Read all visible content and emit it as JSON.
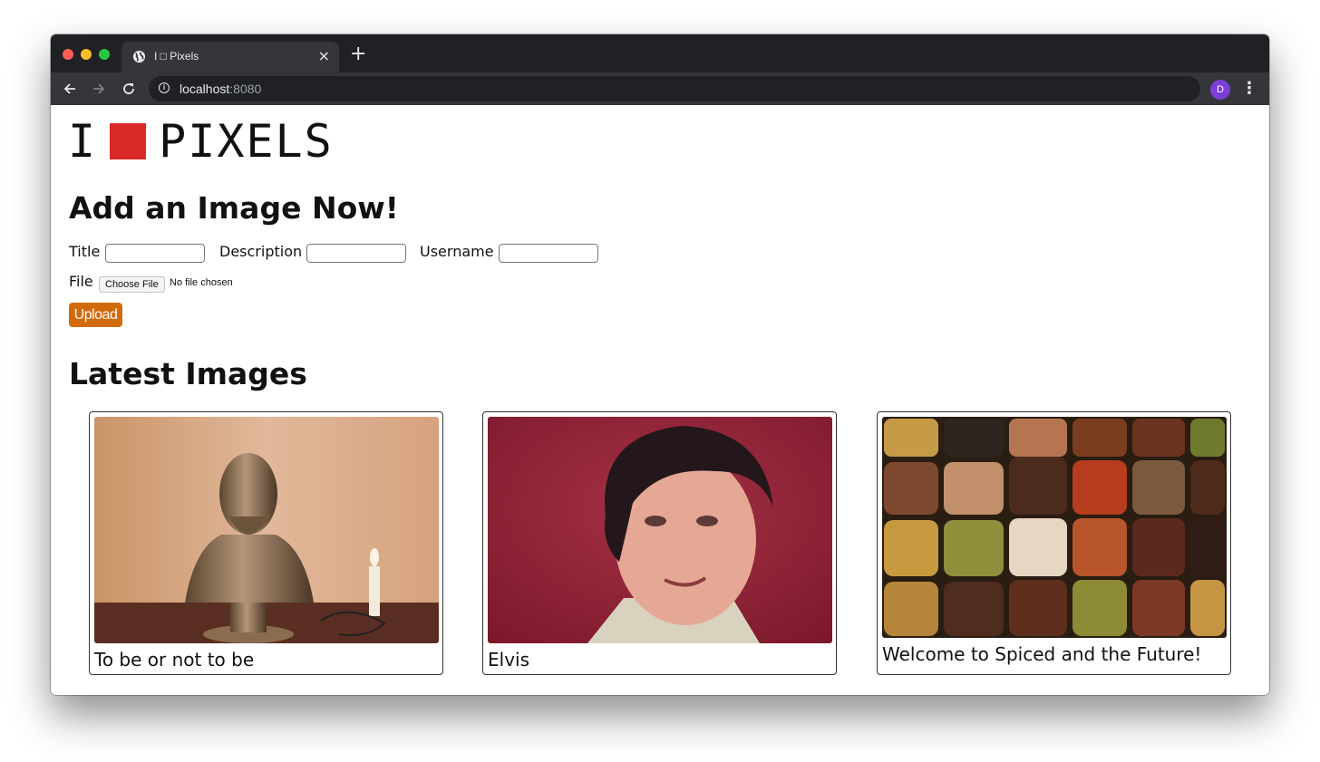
{
  "browser": {
    "tab_title": "I □ Pixels",
    "tab_close": "×",
    "new_tab": "+",
    "url_host": "localhost",
    "url_port": ":8080",
    "profile_initial": "D",
    "icons": {
      "back": "arrow-left-icon",
      "forward": "arrow-right-icon",
      "reload": "reload-icon",
      "info": "info-icon",
      "bookmark": "star-icon",
      "menu": "kebab-menu-icon",
      "favicon": "globe-icon"
    }
  },
  "page": {
    "logo_left": "I",
    "logo_right": "PIXELS",
    "logo_color": "#d92a27",
    "add_heading": "Add an Image Now!",
    "form": {
      "title_label": "Title",
      "description_label": "Description",
      "username_label": "Username",
      "file_label": "File",
      "file_button": "Choose File",
      "file_status": "No file chosen",
      "upload_label": "Upload",
      "upload_color": "#d26a0c"
    },
    "latest_heading": "Latest Images",
    "images": [
      {
        "caption": "To be or not to be",
        "subject": "bronze bust of Shakespeare beside a candle lamp"
      },
      {
        "caption": "Elvis",
        "subject": "portrait of a man with dark hair on red background"
      },
      {
        "caption": "Welcome to Spiced and the Future!",
        "subject": "colorful bins of spices"
      }
    ]
  }
}
